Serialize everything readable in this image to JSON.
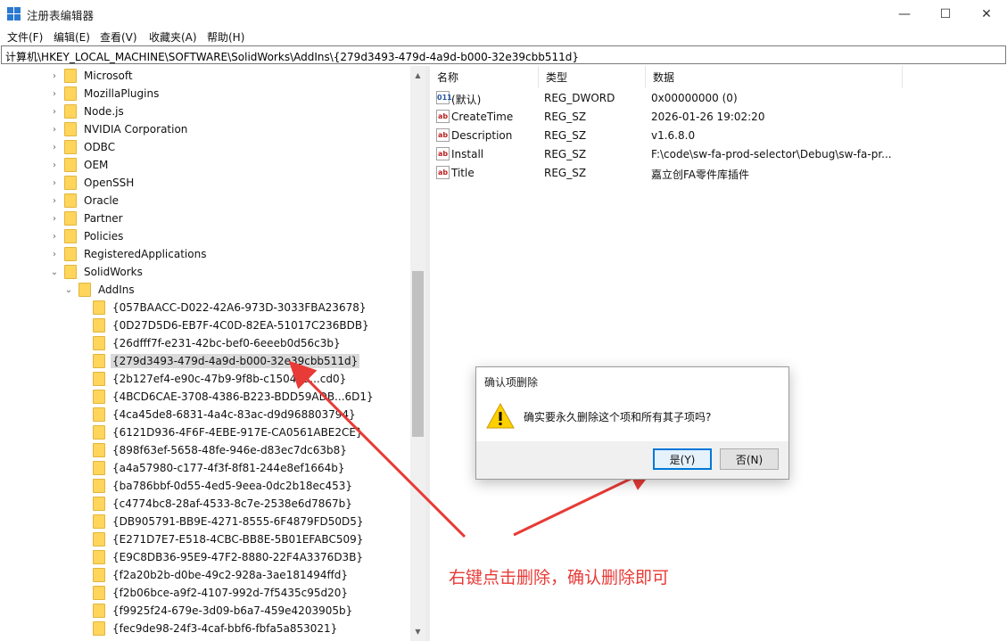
{
  "window": {
    "title": "注册表编辑器",
    "controls": {
      "minimize": "—",
      "maximize": "☐",
      "close": "✕"
    }
  },
  "menu": [
    "文件(F)",
    "编辑(E)",
    "查看(V)",
    "收藏夹(A)",
    "帮助(H)"
  ],
  "address": "计算机\\HKEY_LOCAL_MACHINE\\SOFTWARE\\SolidWorks\\AddIns\\{279d3493-479d-4a9d-b000-32e39cbb511d}",
  "tree": {
    "items": [
      {
        "label": "Microsoft",
        "arrow": "›"
      },
      {
        "label": "MozillaPlugins",
        "arrow": "›"
      },
      {
        "label": "Node.js",
        "arrow": "›"
      },
      {
        "label": "NVIDIA Corporation",
        "arrow": "›"
      },
      {
        "label": "ODBC",
        "arrow": "›"
      },
      {
        "label": "OEM",
        "arrow": "›"
      },
      {
        "label": "OpenSSH",
        "arrow": "›"
      },
      {
        "label": "Oracle",
        "arrow": "›"
      },
      {
        "label": "Partner",
        "arrow": "›"
      },
      {
        "label": "Policies",
        "arrow": "›"
      },
      {
        "label": "RegisteredApplications",
        "arrow": "›"
      },
      {
        "label": "SolidWorks",
        "arrow": "⌄"
      },
      {
        "label": "AddIns",
        "arrow": "⌄"
      },
      {
        "label": "{057BAACC-D022-42A6-973D-3033FBA23678}",
        "arrow": ""
      },
      {
        "label": "{0D27D5D6-EB7F-4C0D-82EA-51017C236BDB}",
        "arrow": ""
      },
      {
        "label": "{26dfff7f-e231-42bc-bef0-6eeeb0d56c3b}",
        "arrow": ""
      },
      {
        "label": "{279d3493-479d-4a9d-b000-32e39cbb511d}",
        "arrow": ""
      },
      {
        "label": "{2b127ef4-e90c-47b9-9f8b-c15040a...cd0}",
        "arrow": ""
      },
      {
        "label": "{4BCD6CAE-3708-4386-B223-BDD59ADB...6D1}",
        "arrow": ""
      },
      {
        "label": "{4ca45de8-6831-4a4c-83ac-d9d968803794}",
        "arrow": ""
      },
      {
        "label": "{6121D936-4F6F-4EBE-917E-CA0561ABE2CE}",
        "arrow": ""
      },
      {
        "label": "{898f63ef-5658-48fe-946e-d83ec7dc63b8}",
        "arrow": ""
      },
      {
        "label": "{a4a57980-c177-4f3f-8f81-244e8ef1664b}",
        "arrow": ""
      },
      {
        "label": "{ba786bbf-0d55-4ed5-9eea-0dc2b18ec453}",
        "arrow": ""
      },
      {
        "label": "{c4774bc8-28af-4533-8c7e-2538e6d7867b}",
        "arrow": ""
      },
      {
        "label": "{DB905791-BB9E-4271-8555-6F4879FD50D5}",
        "arrow": ""
      },
      {
        "label": "{E271D7E7-E518-4CBC-BB8E-5B01EFABC509}",
        "arrow": ""
      },
      {
        "label": "{E9C8DB36-95E9-47F2-8880-22F4A3376D3B}",
        "arrow": ""
      },
      {
        "label": "{f2a20b2b-d0be-49c2-928a-3ae181494ffd}",
        "arrow": ""
      },
      {
        "label": "{f2b06bce-a9f2-4107-992d-7f5435c95d20}",
        "arrow": ""
      },
      {
        "label": "{f9925f24-679e-3d09-b6a7-459e4203905b}",
        "arrow": ""
      },
      {
        "label": "{fec9de98-24f3-4caf-bbf6-fbfa5a853021}",
        "arrow": ""
      }
    ],
    "selected_index": 16
  },
  "list": {
    "columns": [
      "名称",
      "类型",
      "数据"
    ],
    "rows": [
      {
        "icon": "dword-value-icon",
        "icon_glyph": "011",
        "name": "(默认)",
        "type": "REG_DWORD",
        "data": "0x00000000 (0)"
      },
      {
        "icon": "string-value-icon",
        "icon_glyph": "ab",
        "name": "CreateTime",
        "type": "REG_SZ",
        "data": "2026-01-26 19:02:20"
      },
      {
        "icon": "string-value-icon",
        "icon_glyph": "ab",
        "name": "Description",
        "type": "REG_SZ",
        "data": "v1.6.8.0"
      },
      {
        "icon": "string-value-icon",
        "icon_glyph": "ab",
        "name": "Install",
        "type": "REG_SZ",
        "data": "F:\\code\\sw-fa-prod-selector\\Debug\\sw-fa-pr..."
      },
      {
        "icon": "string-value-icon",
        "icon_glyph": "ab",
        "name": "Title",
        "type": "REG_SZ",
        "data": "嘉立创FA零件库插件"
      }
    ]
  },
  "dialog": {
    "title": "确认项删除",
    "message": "确实要永久删除这个项和所有其子项吗?",
    "yes_label": "是(Y)",
    "no_label": "否(N)"
  },
  "annotation": {
    "text": "右键点击删除，确认删除即可",
    "color": "#e83a36"
  },
  "colors": {
    "folder": "#ffd55c",
    "accent": "#0078d7",
    "selection": "#d9d9d9"
  }
}
